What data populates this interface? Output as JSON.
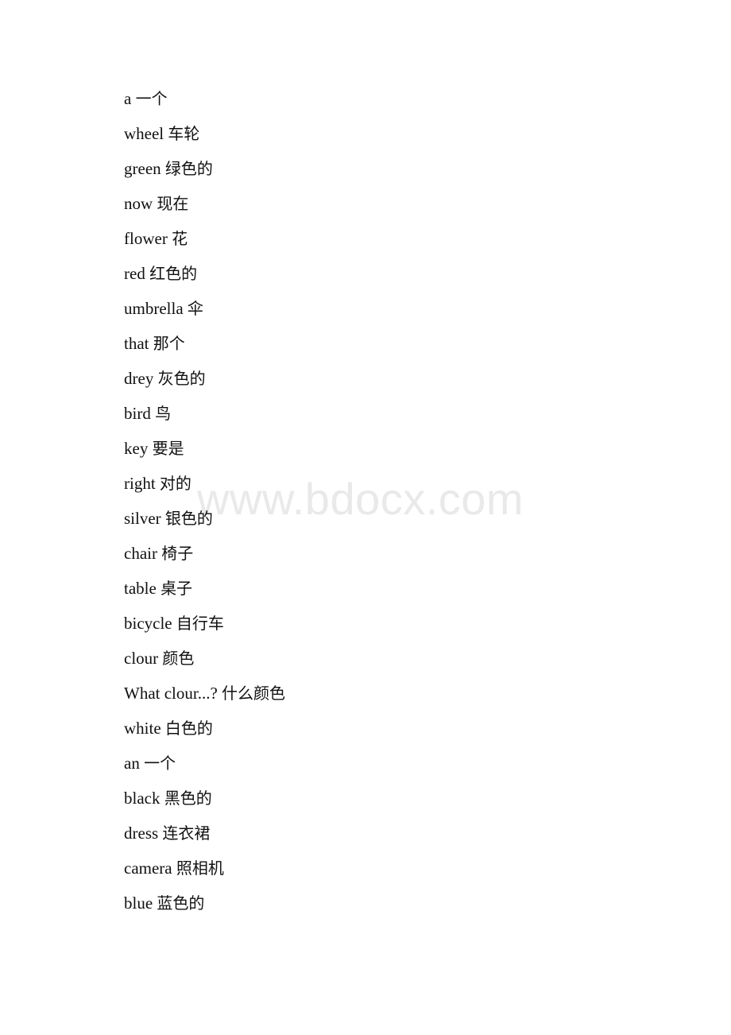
{
  "document": {
    "page_background": "#ffffff",
    "text_color": "#111111",
    "watermark": {
      "text": "www.bdocx.com",
      "color": "#e9e9e9"
    },
    "vocabulary": [
      {
        "english": "a",
        "chinese": "一个"
      },
      {
        "english": "wheel",
        "chinese": "车轮"
      },
      {
        "english": "green",
        "chinese": "绿色的"
      },
      {
        "english": "now",
        "chinese": "现在"
      },
      {
        "english": "flower",
        "chinese": "花"
      },
      {
        "english": "red",
        "chinese": "红色的"
      },
      {
        "english": "umbrella",
        "chinese": "伞"
      },
      {
        "english": "that",
        "chinese": "那个"
      },
      {
        "english": "drey",
        "chinese": "灰色的"
      },
      {
        "english": "bird",
        "chinese": "鸟"
      },
      {
        "english": "key",
        "chinese": "要是"
      },
      {
        "english": "right",
        "chinese": "对的"
      },
      {
        "english": "silver",
        "chinese": "银色的"
      },
      {
        "english": "chair",
        "chinese": "椅子"
      },
      {
        "english": "table",
        "chinese": "桌子"
      },
      {
        "english": "bicycle",
        "chinese": "自行车"
      },
      {
        "english": "clour",
        "chinese": "颜色"
      },
      {
        "english": "What clour...?",
        "chinese": "什么颜色"
      },
      {
        "english": "white",
        "chinese": "白色的"
      },
      {
        "english": "an",
        "chinese": "一个"
      },
      {
        "english": "black",
        "chinese": "黑色的"
      },
      {
        "english": "dress",
        "chinese": "连衣裙"
      },
      {
        "english": "camera",
        "chinese": "照相机"
      },
      {
        "english": "blue",
        "chinese": "蓝色的"
      }
    ]
  }
}
